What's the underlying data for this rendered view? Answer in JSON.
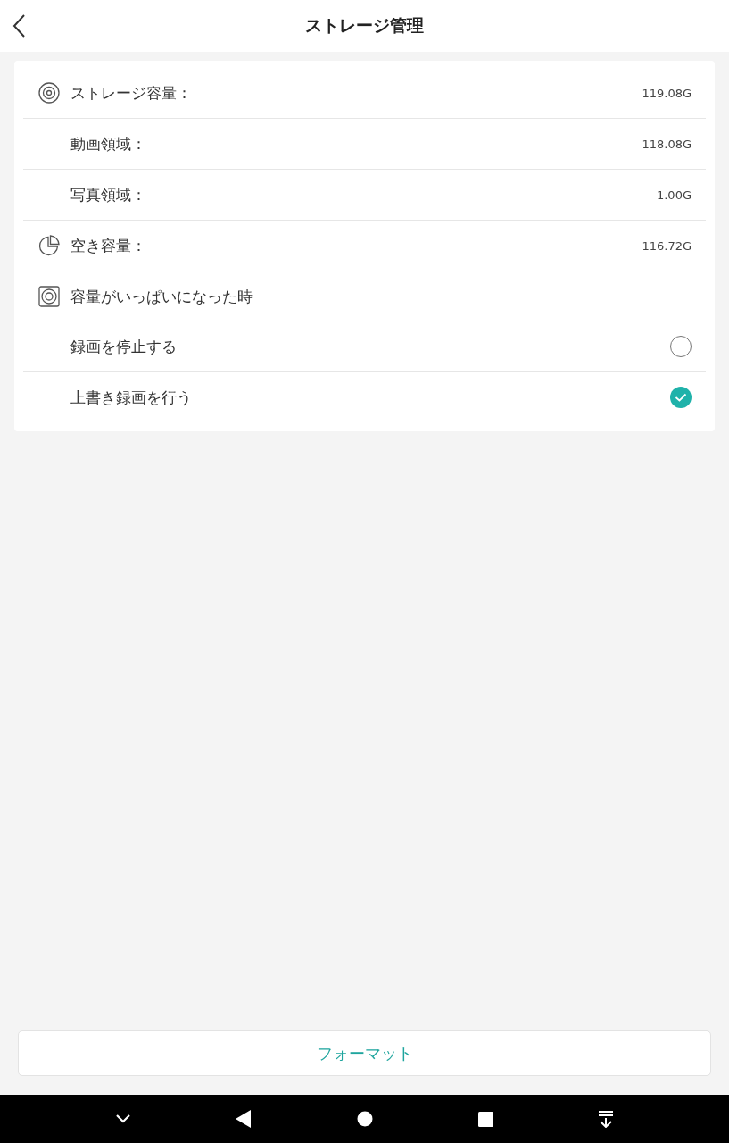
{
  "header": {
    "title": "ストレージ管理"
  },
  "rows": [
    {
      "kind": "value",
      "label": "ストレージ容量：",
      "value": "119.08G"
    },
    {
      "kind": "value",
      "label": "動画領域：",
      "value": "118.08G"
    },
    {
      "kind": "value",
      "label": "写真領域：",
      "value": "1.00G"
    },
    {
      "kind": "value",
      "label": "空き容量：",
      "value": "116.72G"
    },
    {
      "kind": "heading",
      "label": "容量がいっぱいになった時"
    },
    {
      "kind": "option",
      "label": "録画を停止する",
      "selected": false
    },
    {
      "kind": "option",
      "label": "上書き録画を行う",
      "selected": true
    }
  ],
  "format_button": {
    "label": "フォーマット"
  }
}
